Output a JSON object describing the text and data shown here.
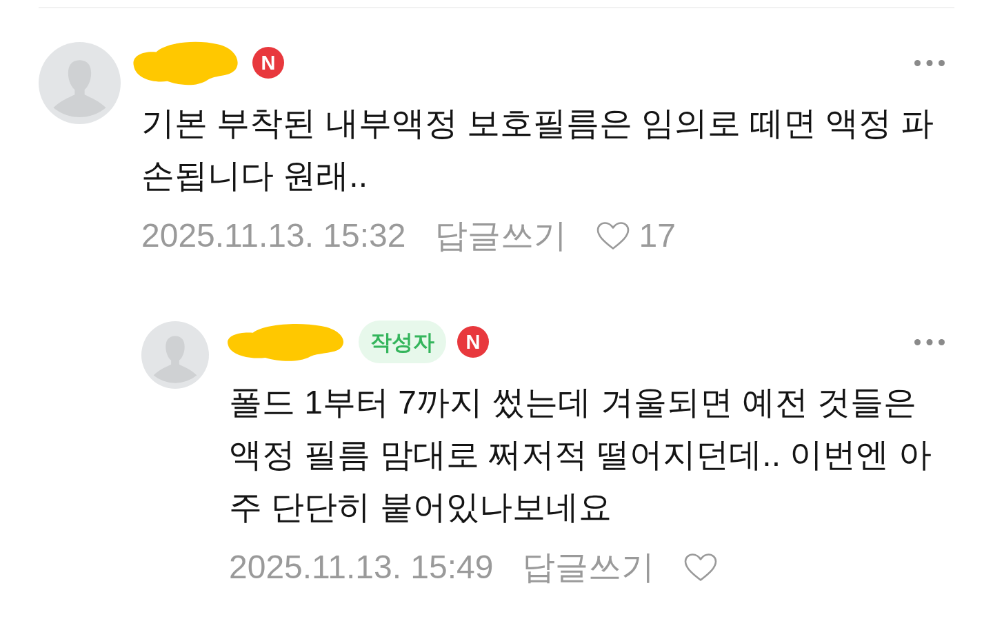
{
  "comments": [
    {
      "author": {
        "redacted": true,
        "badges": [
          {
            "kind": "new",
            "text": "N"
          }
        ]
      },
      "text": "기본 부착된 내부액정 보호필름은 임의로 떼면 액정 파손됩니다 원래..",
      "date": "2025.11.13. 15:32",
      "reply_link": "답글쓰기",
      "like": {
        "liked": false,
        "count": "17"
      },
      "replies": [
        {
          "author": {
            "redacted": true,
            "badges": [
              {
                "kind": "writer",
                "text": "작성자"
              },
              {
                "kind": "new",
                "text": "N"
              }
            ]
          },
          "text": "폴드 1부터 7까지 썼는데 겨울되면 예전 것들은 액정 필름 맘대로 쩌저적 떨어지던데.. 이번엔 아주 단단히 붙어있나보네요",
          "date": "2025.11.13. 15:49",
          "reply_link": "답글쓰기",
          "like": {
            "liked": false
          }
        }
      ]
    }
  ]
}
